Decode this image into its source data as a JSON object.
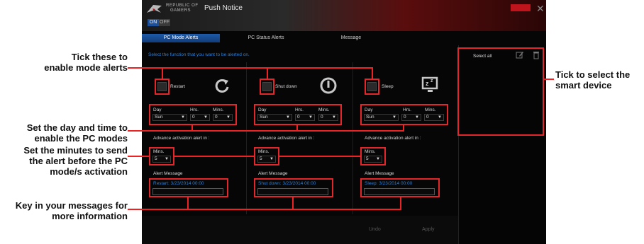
{
  "window": {
    "brand_line1": "REPUBLIC OF",
    "brand_line2": "GAMERS",
    "title": "Push Notice",
    "toggle_on": "ON",
    "toggle_off": "OFF"
  },
  "tabs": [
    "PC Mode Alerts",
    "PC Status Alerts",
    "Message"
  ],
  "instruction": "Select the function that you want to be alerted on.",
  "modes": [
    {
      "label": "Restart",
      "day": "Sun",
      "hrs": "0",
      "mins": "0",
      "advance_mins": "5",
      "alert_message": "Restart: 3/23/2014 00:00"
    },
    {
      "label": "Shut down",
      "day": "Sun",
      "hrs": "0",
      "mins": "0",
      "advance_mins": "5",
      "alert_message": "Shut down: 3/23/2014 00:00"
    },
    {
      "label": "Sleep",
      "day": "Sun",
      "hrs": "0",
      "mins": "0",
      "advance_mins": "5",
      "alert_message": "Sleep: 3/23/2014 00:00"
    }
  ],
  "field_labels": {
    "day": "Day",
    "hrs": "Hrs.",
    "mins": "Mins.",
    "advance": "Advance activation alert in :",
    "alert_message": "Alert Message"
  },
  "side_panel": {
    "select_all": "Select all"
  },
  "buttons": {
    "undo": "Undo",
    "apply": "Apply"
  },
  "callouts": {
    "mode_alerts": [
      "Tick these to",
      "enable mode alerts"
    ],
    "day_time": [
      "Set the day and time to",
      "enable the PC modes"
    ],
    "minutes": [
      "Set the minutes to send",
      "the alert before the PC",
      "mode/s activation"
    ],
    "messages": [
      "Key in your messages for",
      "more information"
    ],
    "smart_device": [
      "Tick to select the",
      "smart device"
    ]
  },
  "colors": {
    "accent_red": "#e3262a",
    "tab_blue": "#1e5aa8",
    "text_blue": "#2e7fd6"
  }
}
